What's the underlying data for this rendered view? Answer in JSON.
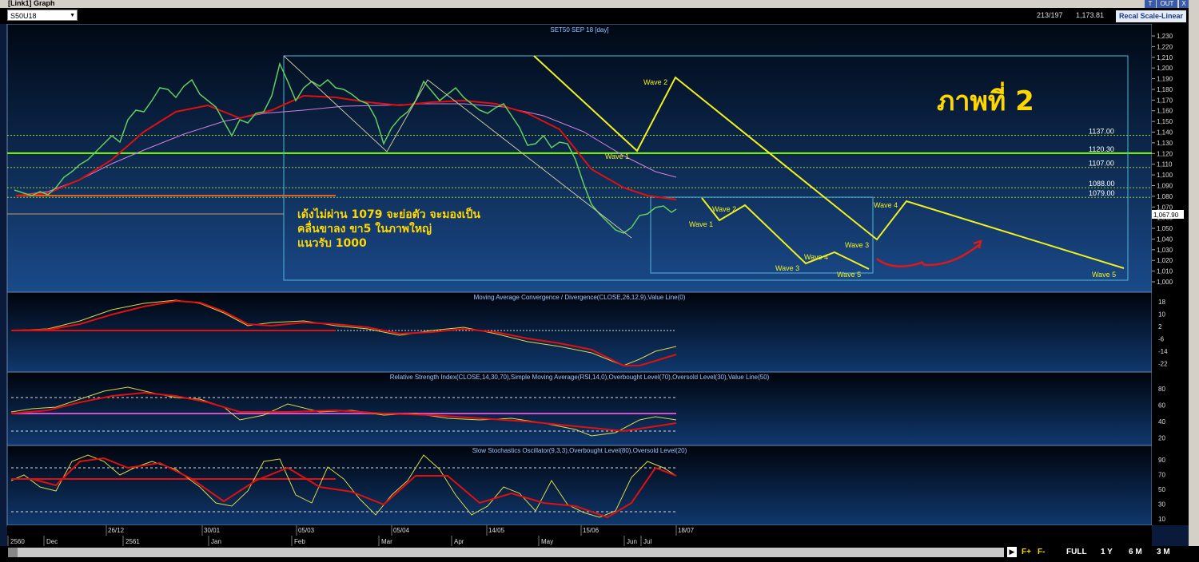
{
  "window": {
    "title": "[Link1] Graph",
    "buttons": [
      "T",
      "OUT",
      "X"
    ]
  },
  "toolbar": {
    "symbol": "S50U18",
    "ratio": "213/197",
    "price": "1,173.81",
    "recal_label": "Recal Scale-Linear"
  },
  "main_panel": {
    "title": "SET50 SEP 18  [day]",
    "y_ticks": [
      "1,230",
      "1,220",
      "1,210",
      "1,200",
      "1,190",
      "1,180",
      "1,170",
      "1,160",
      "1,150",
      "1,140",
      "1,130",
      "1,120",
      "1,110",
      "1,100",
      "1,090",
      "1,080",
      "1,070",
      "1,060",
      "1,050",
      "1,040",
      "1,030",
      "1,020",
      "1,010",
      "1,000"
    ],
    "current_price": "1,067.90",
    "levels": [
      {
        "label": "1137.00",
        "value": 1137,
        "color": "#9acd32",
        "style": "dotted"
      },
      {
        "label": "1120.30",
        "value": 1120.3,
        "color": "#7fff00",
        "style": "solid"
      },
      {
        "label": "1107.00",
        "value": 1107,
        "color": "#9acd32",
        "style": "dotted"
      },
      {
        "label": "1088.00",
        "value": 1088,
        "color": "#9acd32",
        "style": "dotted"
      },
      {
        "label": "1079.00",
        "value": 1079,
        "color": "#9acd32",
        "style": "dotted"
      }
    ],
    "heading": "ภาพที่ 2",
    "note": [
      "เด้งไม่ผ่าน 1079 จะย่อตัว จะมองเป็น",
      "คลื่นขาลง ขา5 ในภาพใหญ่",
      "แนวรับ 1000"
    ],
    "wave_labels": [
      "Wave 2",
      "Wave 1",
      "Wave 2",
      "Wave 1",
      "Wave 4",
      "Wave 3",
      "Wave 4",
      "Wave 3",
      "Wave 5",
      "Wave 5"
    ]
  },
  "macd": {
    "title": "Moving Average Convergence / Divergence(CLOSE,26,12,9),Value Line(0)",
    "ticks": [
      "18",
      "10",
      "2",
      "-6",
      "-14",
      "-22"
    ]
  },
  "rsi": {
    "title": "Relative Strength Index(CLOSE,14,30,70),Simple Moving Average(RSI,14,0),Overbought Level(70),Oversold Level(30),Value Line(50)",
    "ticks": [
      "80",
      "60",
      "40",
      "20"
    ]
  },
  "stoch": {
    "title": "Slow Stochastics Oscillator(9,3,3),Overbought Level(80),Oversold Level(20)",
    "ticks": [
      "90",
      "70",
      "50",
      "30",
      "10"
    ]
  },
  "x_axis": {
    "dates": [
      "26/12",
      "30/01",
      "05/03",
      "05/04",
      "14/05",
      "15/06",
      "18/07"
    ],
    "months": [
      "2560",
      "Dec",
      "2561",
      "Jan",
      "Feb",
      "Mar",
      "Apr",
      "May",
      "Jun",
      "Jul"
    ]
  },
  "timeframes": [
    "FULL",
    "1 Y",
    "6 M",
    "3 M"
  ]
}
